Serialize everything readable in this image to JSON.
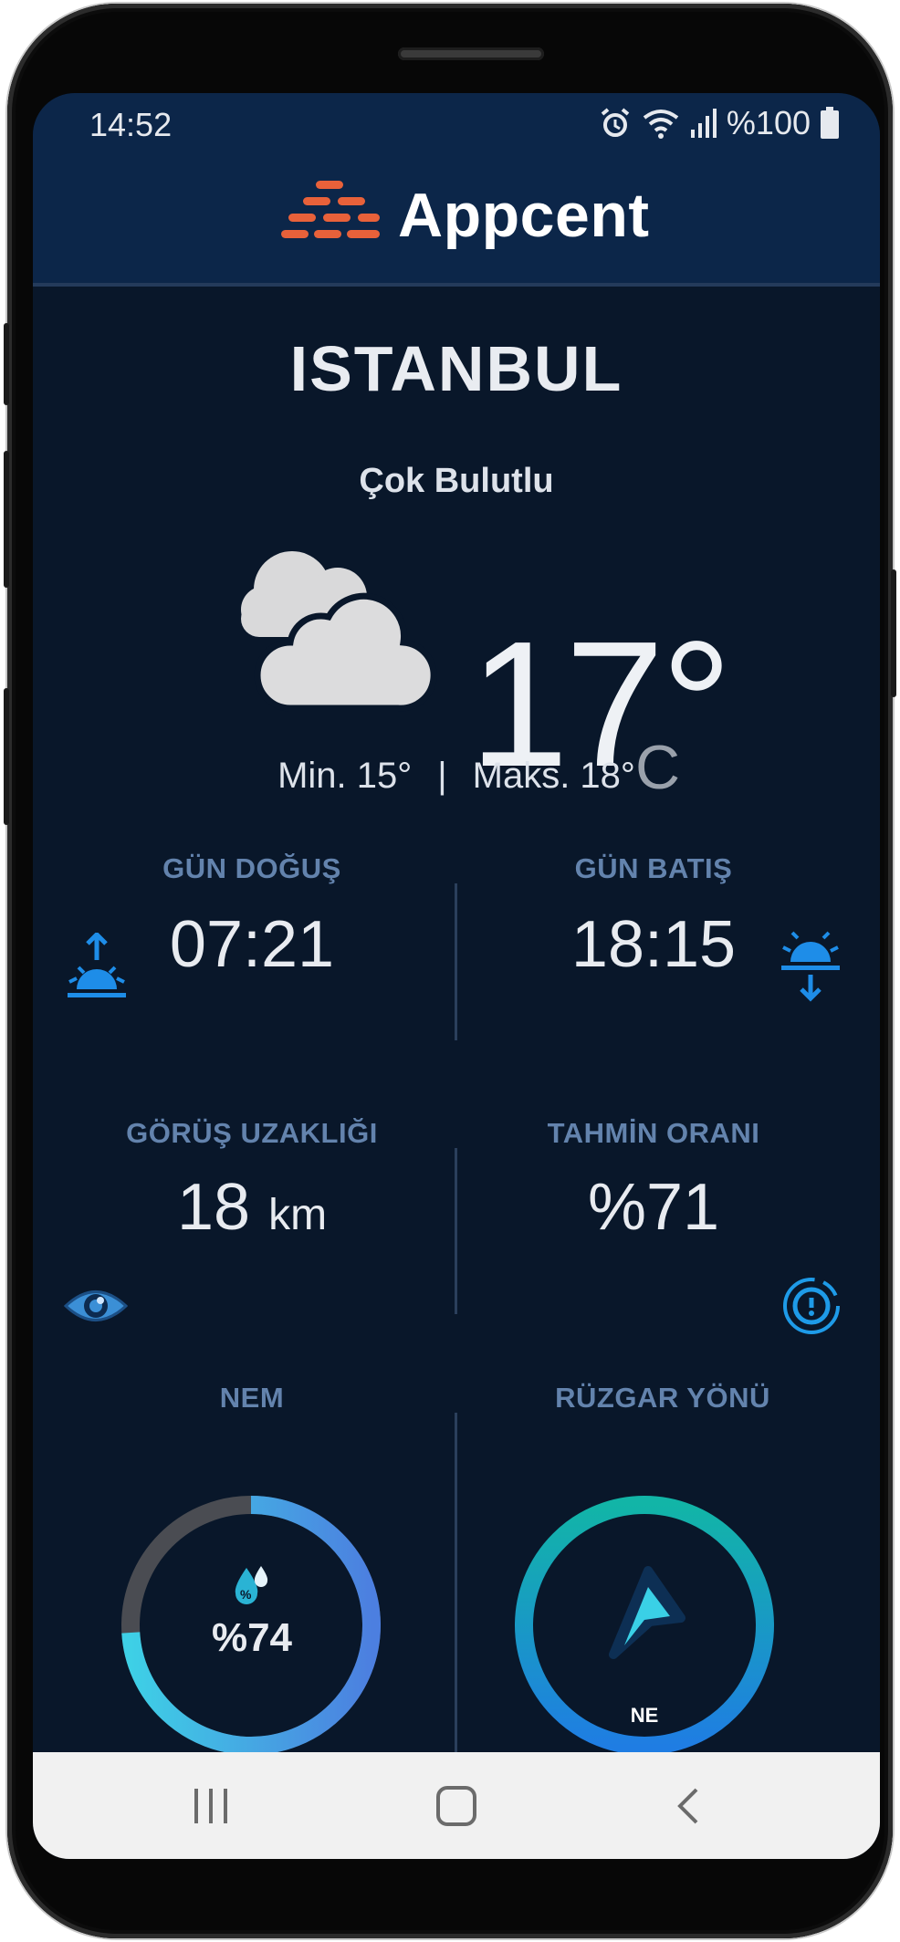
{
  "status_bar": {
    "time": "14:52",
    "battery_text": "%100",
    "icons": [
      "alarm-icon",
      "wifi-icon",
      "signal-icon",
      "battery-icon"
    ]
  },
  "header": {
    "app_name": "Appcent",
    "logo_icon": "appcent-logo-icon"
  },
  "weather": {
    "city": "ISTANBUL",
    "condition": "Çok Bulutlu",
    "condition_icon": "partly-cloudy-icon",
    "temperature": "17°",
    "unit": "C",
    "min_text": "Min. 15°",
    "separator": "|",
    "max_text": "Maks. 18°"
  },
  "details": {
    "sunrise": {
      "label": "GÜN DOĞUŞ",
      "value": "07:21",
      "icon": "sunrise-icon"
    },
    "sunset": {
      "label": "GÜN BATIŞ",
      "value": "18:15",
      "icon": "sunset-icon"
    },
    "visibility": {
      "label": "GÖRÜŞ UZAKLIĞI",
      "value": "18",
      "unit": "km",
      "icon": "eye-icon"
    },
    "forecast_rate": {
      "label": "TAHMİN ORANI",
      "value": "%71",
      "icon": "gauge-icon"
    },
    "humidity": {
      "label": "NEM",
      "value": "%74",
      "percent": 74,
      "icon": "droplet-percent-icon"
    },
    "wind_direction": {
      "label": "RÜZGAR YÖNÜ",
      "value": "NE",
      "icon": "compass-arrow-icon"
    }
  },
  "colors": {
    "header_bg": "#0c2649",
    "screen_bg": "#09172a",
    "label": "#6383ad",
    "accent_blue": "#1e8de8",
    "logo_orange": "#e8613a"
  },
  "nav_bar": {
    "items": [
      "recent-apps-icon",
      "home-icon",
      "back-icon"
    ]
  }
}
